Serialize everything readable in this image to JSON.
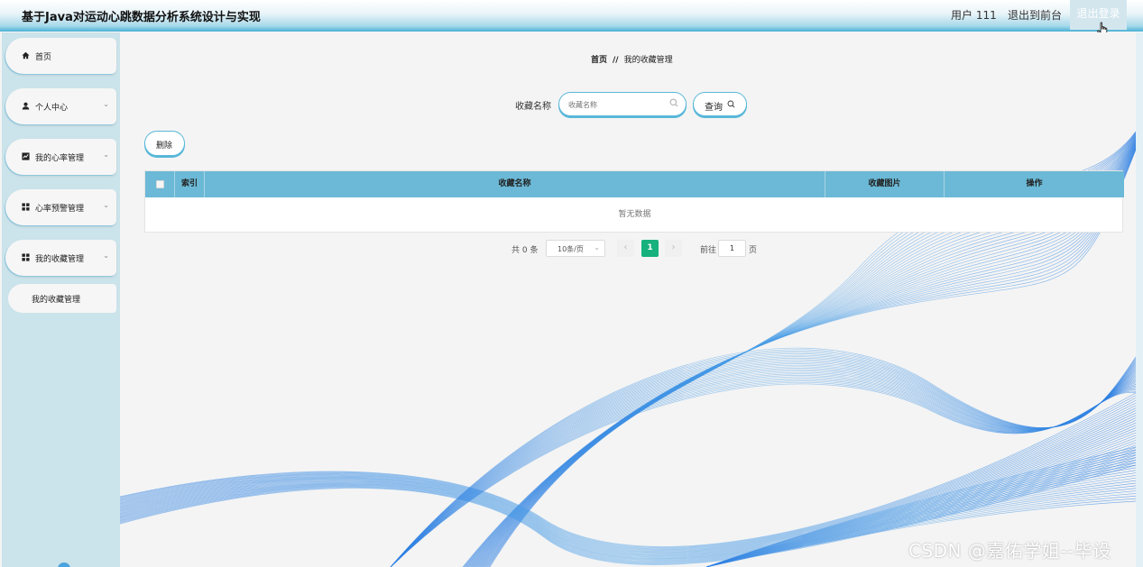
{
  "header": {
    "title": "基于Java对运动心跳数据分析系统设计与实现",
    "user": "用户 111",
    "front": "退出到前台",
    "logout": "退出登录"
  },
  "sidebar": {
    "items": [
      {
        "label": "首页",
        "icon": "home-icon"
      },
      {
        "label": "个人中心",
        "icon": "user-icon"
      },
      {
        "label": "我的心率管理",
        "icon": "chart-icon"
      },
      {
        "label": "心率预警管理",
        "icon": "grid-icon"
      },
      {
        "label": "我的收藏管理",
        "icon": "grid-icon"
      }
    ],
    "sub_item": "我的收藏管理"
  },
  "breadcrumb": {
    "home": "首页",
    "separator": "//",
    "current": "我的收藏管理"
  },
  "search": {
    "label": "收藏名称",
    "placeholder": "收藏名称",
    "button": "查询"
  },
  "toolbar": {
    "delete": "删除"
  },
  "table": {
    "columns": [
      "索引",
      "收藏名称",
      "收藏图片",
      "操作"
    ],
    "empty_text": "暂无数据"
  },
  "pagination": {
    "total": "共 0 条",
    "page_size": "10条/页",
    "current_page": "1",
    "goto_label": "前往",
    "goto_value": "1",
    "page_suffix": "页"
  },
  "watermark": "CSDN @嘉佑学姐--毕设",
  "colors": {
    "header_accent": "#56b8d8",
    "sidebar_bg": "#cbe3ea",
    "table_header": "#6bb9d6",
    "pager_active": "#16b17d",
    "wave_blue": "#2a7de1"
  }
}
